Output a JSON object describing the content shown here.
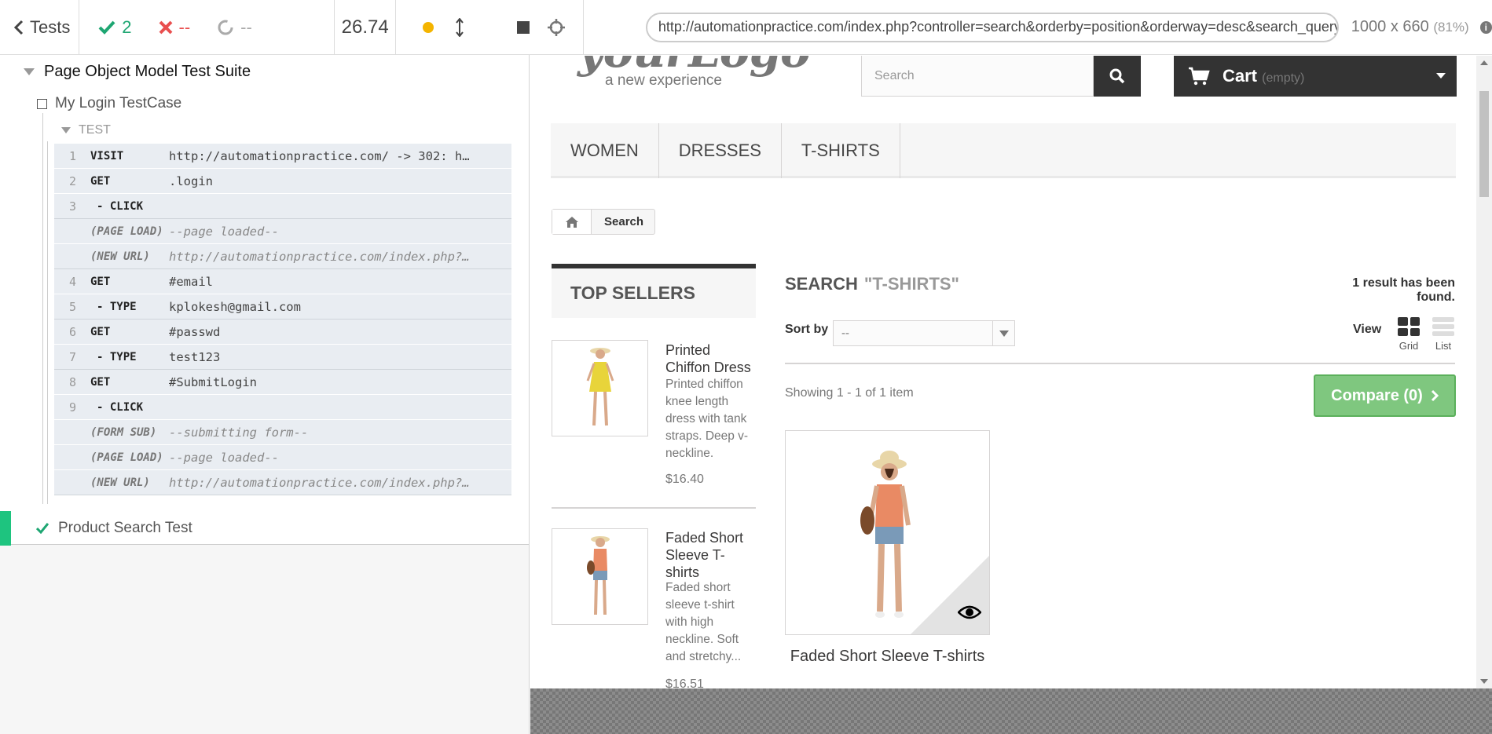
{
  "reporter": {
    "tests_label": "Tests",
    "stats": {
      "passed": "2",
      "failed": "--",
      "pending": "--"
    },
    "duration": "26.74",
    "suite_title": "Page Object Model Test Suite",
    "testcase_title": "My Login TestCase",
    "test_label": "TEST",
    "commands": [
      {
        "num": "1",
        "name": "VISIT",
        "msg": "http://automationpractice.com/ -> 302: h…",
        "kind": "cmd",
        "sub": false
      },
      {
        "num": "2",
        "name": "GET",
        "msg": ".login",
        "kind": "cmd",
        "sub": false
      },
      {
        "num": "3",
        "name": "- CLICK",
        "msg": "",
        "kind": "cmd",
        "sub": true
      },
      {
        "num": "",
        "name": "(PAGE LOAD)",
        "msg": "--page loaded--",
        "kind": "event",
        "sub": false
      },
      {
        "num": "",
        "name": "(NEW URL)",
        "msg": "http://automationpractice.com/index.php?…",
        "kind": "event",
        "sub": false
      },
      {
        "num": "4",
        "name": "GET",
        "msg": "#email",
        "kind": "cmd",
        "sub": false
      },
      {
        "num": "5",
        "name": "- TYPE",
        "msg": "kplokesh@gmail.com",
        "kind": "cmd",
        "sub": true
      },
      {
        "num": "6",
        "name": "GET",
        "msg": "#passwd",
        "kind": "cmd",
        "sub": false
      },
      {
        "num": "7",
        "name": "- TYPE",
        "msg": "test123",
        "kind": "cmd",
        "sub": true
      },
      {
        "num": "8",
        "name": "GET",
        "msg": "#SubmitLogin",
        "kind": "cmd",
        "sub": false
      },
      {
        "num": "9",
        "name": "- CLICK",
        "msg": "",
        "kind": "cmd",
        "sub": true
      },
      {
        "num": "",
        "name": "(FORM SUB)",
        "msg": "--submitting form--",
        "kind": "event",
        "sub": false
      },
      {
        "num": "",
        "name": "(PAGE LOAD)",
        "msg": "--page loaded--",
        "kind": "event",
        "sub": false
      },
      {
        "num": "",
        "name": "(NEW URL)",
        "msg": "http://automationpractice.com/index.php?…",
        "kind": "event",
        "sub": false
      }
    ],
    "test2_title": "Product Search Test"
  },
  "aut": {
    "url": "http://automationpractice.com/index.php?controller=search&orderby=position&orderway=desc&search_query=T-shirts&submit_search=",
    "viewport": "1000 x 660",
    "scale": "(81%)",
    "info": "i"
  },
  "page": {
    "logo_text": "yourLogo",
    "logo_sub": "a new experience",
    "search_placeholder": "Search",
    "cart_label": "Cart",
    "cart_status": "(empty)",
    "menu": [
      "Women",
      "Dresses",
      "T-shirts"
    ],
    "breadcrumb": "Search",
    "top_sellers_title": "Top sellers",
    "top_sellers": [
      {
        "name": "Printed Chiffon Dress",
        "desc": "Printed chiffon knee length dress with tank straps. Deep v-neckline.",
        "price": "$16.40"
      },
      {
        "name": "Faded Short Sleeve T-shirts",
        "desc": "Faded short sleeve t-shirt with high neckline. Soft and stretchy...",
        "price": "$16.51"
      }
    ],
    "search_label": "Search",
    "search_query": "\"T-shirts\"",
    "result_count": "1 result has been found.",
    "sort_label": "Sort by",
    "sort_value": "--",
    "view_label": "View",
    "view_grid": "Grid",
    "view_list": "List",
    "showing": "Showing 1 - 1 of 1 item",
    "compare": "Compare (0)",
    "product_title": "Faded Short Sleeve T-shirts"
  },
  "colors": {
    "pass": "#1ea672",
    "fail": "#e94f4f",
    "running": "#f4b400",
    "compare": "#7fc77f",
    "dark": "#333333"
  }
}
